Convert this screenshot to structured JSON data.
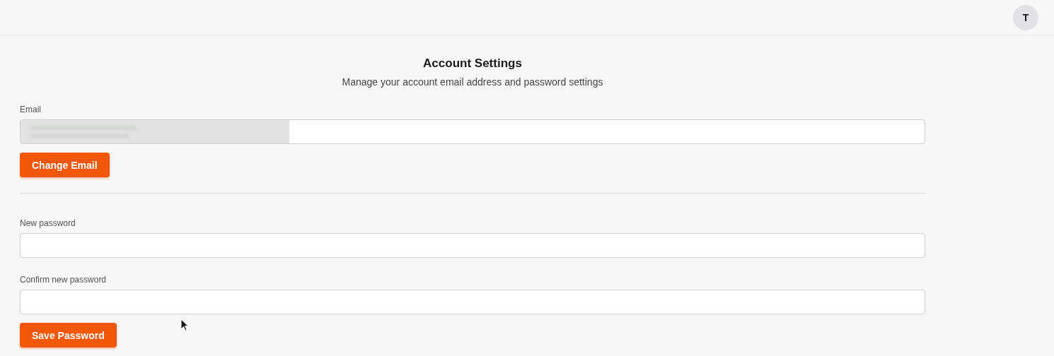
{
  "header": {
    "avatar": "T"
  },
  "title": "Account Settings",
  "subtitle": "Manage your account email address and password settings",
  "email": {
    "label": "Email",
    "redacted": true,
    "button": "Change Email"
  },
  "password": {
    "fields": [
      {
        "label": "New password"
      },
      {
        "label": "Confirm new password"
      }
    ],
    "button": "Save Password"
  }
}
